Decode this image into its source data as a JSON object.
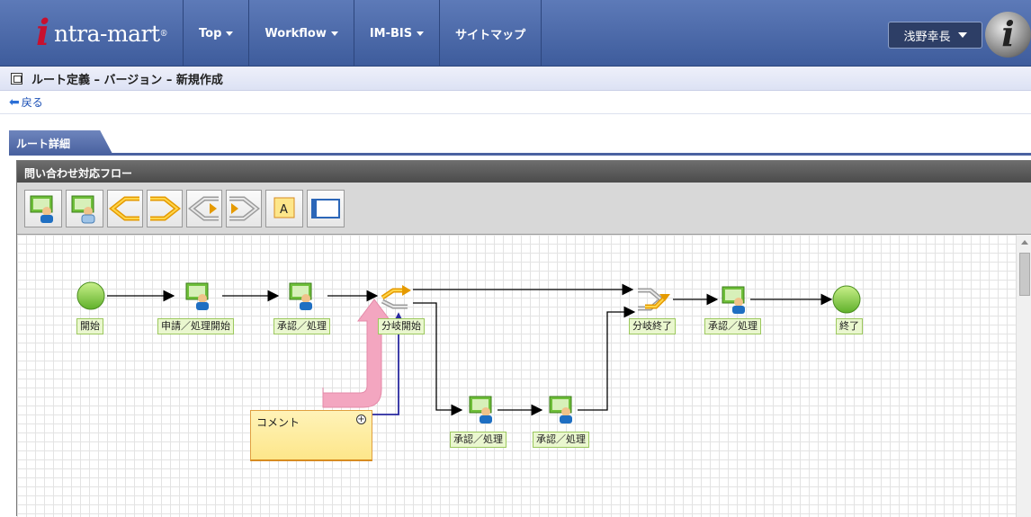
{
  "app": {
    "logo_i": "i",
    "logo_text": "ntra-mart",
    "logo_reg": "®"
  },
  "nav": [
    {
      "label": "Top"
    },
    {
      "label": "Workflow"
    },
    {
      "label": "IM-BIS"
    },
    {
      "label": "サイトマップ"
    }
  ],
  "user": {
    "name": "浅野幸長",
    "avatar_glyph": "i"
  },
  "page": {
    "title": "ルート定義 – バージョン – 新規作成",
    "back": "戻る",
    "tab": "ルート詳細"
  },
  "editor": {
    "flow_name": "問い合わせ対応フロー",
    "toolbar": [
      {
        "icon": "user-task-icon"
      },
      {
        "icon": "user-task-alt-icon"
      },
      {
        "icon": "branch-start-icon"
      },
      {
        "icon": "branch-end-icon"
      },
      {
        "icon": "parallel-start-icon"
      },
      {
        "icon": "parallel-end-icon"
      },
      {
        "icon": "text-label-icon"
      },
      {
        "icon": "comment-box-icon"
      }
    ],
    "nodes": {
      "start": "開始",
      "apply": "申請／処理開始",
      "approve1": "承認／処理",
      "branch_start": "分岐開始",
      "branch_end": "分岐終了",
      "approve2": "承認／処理",
      "end": "終了",
      "approve3": "承認／処理",
      "approve4": "承認／処理"
    },
    "comment": "コメント",
    "colors": {
      "node_label_bg": "#eaf7cf",
      "comment_bg": "#fde68a",
      "highlight_arrow": "#f3a6c0",
      "link_line": "#2a2aa0"
    }
  }
}
